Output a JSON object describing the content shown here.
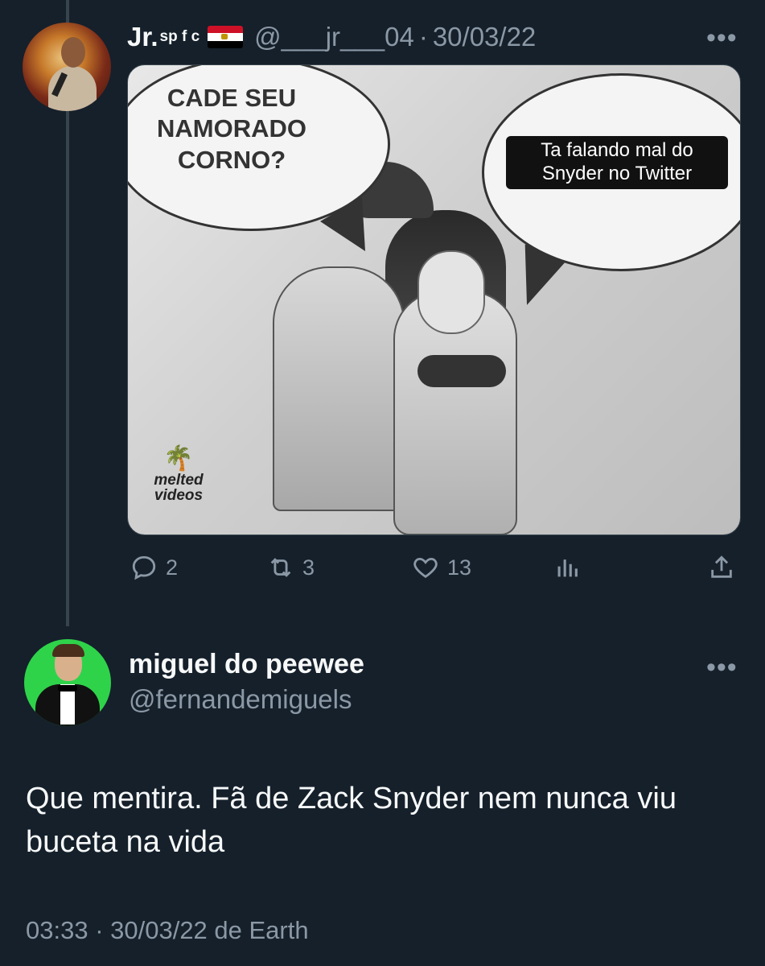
{
  "reply_tweet": {
    "display_name": "Jr.",
    "name_suffix": "sp f c",
    "flag": "egypt-flag",
    "handle": "@___jr___04",
    "separator": "·",
    "date": "30/03/22",
    "more_icon": "more-horizontal-icon",
    "media": {
      "speech_bubble_left": "CADE SEU NAMORADO CORNO?",
      "speech_bubble_right": "Ta falando mal do Snyder no Twitter",
      "watermark": "melted videos"
    },
    "actions": {
      "replies": "2",
      "retweets": "3",
      "likes": "13"
    }
  },
  "main_tweet": {
    "display_name": "miguel do peewee",
    "handle": "@fernandemiguels",
    "text": "Que mentira. Fã de Zack Snyder nem nunca viu buceta na vida",
    "timestamp": "03:33 · 30/03/22 de Earth"
  },
  "colors": {
    "background": "#15202b",
    "text_primary": "#f7f9f9",
    "text_secondary": "#8b98a5",
    "thread_line": "#38444d"
  }
}
